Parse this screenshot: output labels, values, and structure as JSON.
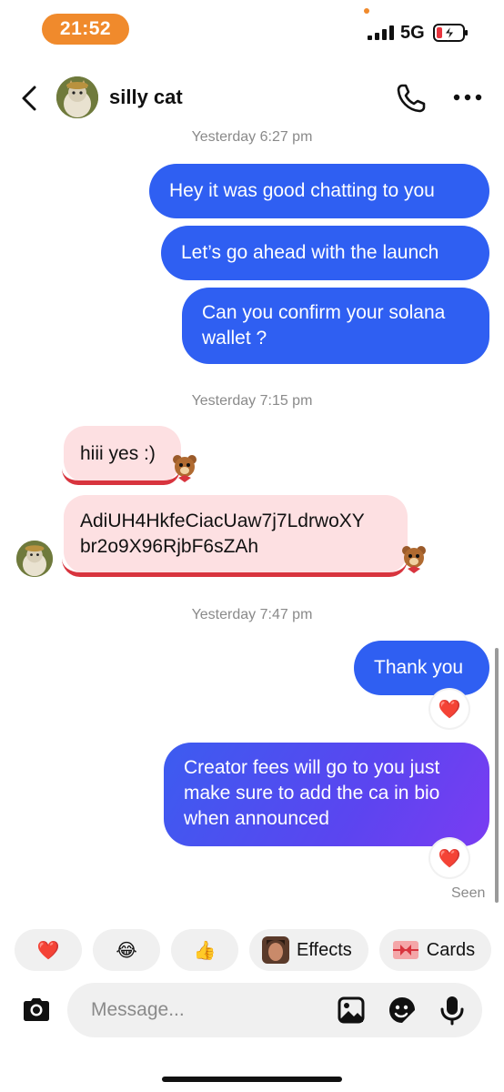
{
  "status_bar": {
    "time": "21:52",
    "network": "5G"
  },
  "header": {
    "contact_name": "silly cat"
  },
  "messages": {
    "timestamp_1": "Yesterday 6:27 pm",
    "out_1": "Hey it was good chatting to you",
    "out_2": "Let’s go ahead with the launch",
    "out_3_line1": "Can you confirm your solana",
    "out_3_line2": "wallet ?",
    "timestamp_2": "Yesterday 7:15 pm",
    "in_1": "hiii yes :)",
    "in_2_line1": "AdiUH4HkfeCiacUaw7j7LdrwoXY",
    "in_2_line2": "br2o9X96RjbF6sZAh",
    "timestamp_3": "Yesterday 7:47 pm",
    "out_4": "Thank you",
    "out_5_line1": "Creator fees will go to you just",
    "out_5_line2": "make sure to add the ca in bio",
    "out_5_line3": "when announced",
    "reaction_emoji": "❤️",
    "seen": "Seen"
  },
  "quick_reactions": {
    "heart": "❤️",
    "laugh": "😂",
    "thumbs": "👍",
    "effects_label": "Effects",
    "cards_label": "Cards"
  },
  "composer": {
    "placeholder": "Message..."
  },
  "colors": {
    "status_pill": "#f08a2c",
    "outgoing_bubble": "#2f5ff2",
    "incoming_bubble": "#fde0e2",
    "incoming_underline": "#d8343e"
  },
  "icons": [
    "back-icon",
    "phone-icon",
    "more-icon",
    "camera-icon",
    "gallery-icon",
    "sticker-icon",
    "mic-icon",
    "bear-sticker-icon"
  ]
}
